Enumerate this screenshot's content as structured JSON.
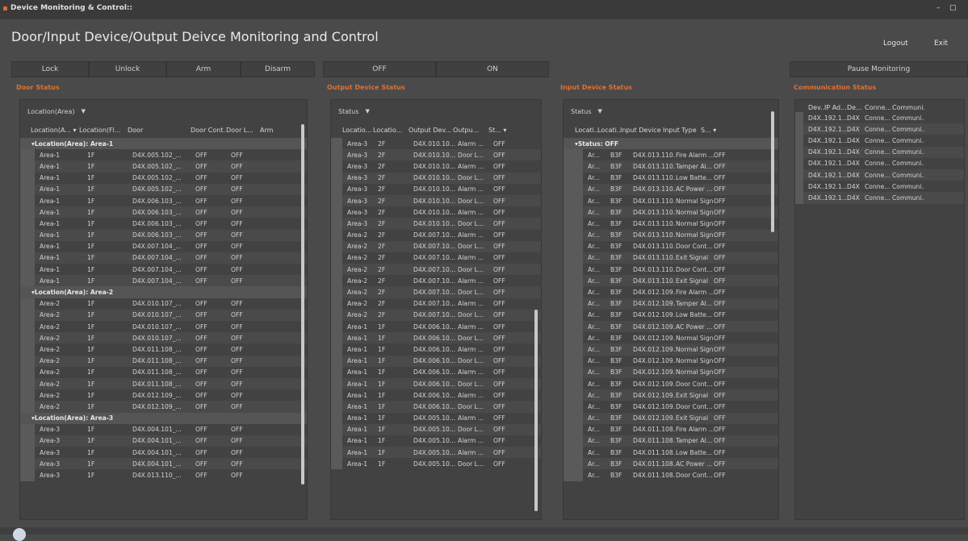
{
  "window": {
    "title": "Device Monitoring & Control::",
    "minimize": "–",
    "maximize": "▢"
  },
  "heading": "Door/Input Device/Output Deivce Monitoring and Control",
  "links": {
    "logout": "Logout",
    "exit": "Exit"
  },
  "door_buttons": [
    "Lock",
    "Unlock",
    "Arm",
    "Disarm"
  ],
  "output_buttons": [
    "OFF",
    "ON"
  ],
  "pause_button": "Pause Monitoring",
  "sections": {
    "door": "Door Status",
    "output": "Output Device Status",
    "input": "Input Device Status",
    "comm": "Communication Status"
  },
  "door_panel": {
    "group_by": "Location(Area)",
    "headers": [
      "Location(A... ▾",
      "Location(Fl...",
      "Door",
      "Door Cont...",
      "Door L...",
      "Arm"
    ],
    "groups": [
      {
        "label": "Location(Area): Area-1",
        "rows": [
          [
            "Area-1",
            "1F",
            "D4X.005.102_...",
            "OFF",
            "OFF"
          ],
          [
            "Area-1",
            "1F",
            "D4X.005.102_...",
            "OFF",
            "OFF"
          ],
          [
            "Area-1",
            "1F",
            "D4X.005.102_...",
            "OFF",
            "OFF"
          ],
          [
            "Area-1",
            "1F",
            "D4X.005.102_...",
            "OFF",
            "OFF"
          ],
          [
            "Area-1",
            "1F",
            "D4X.006.103_...",
            "OFF",
            "OFF"
          ],
          [
            "Area-1",
            "1F",
            "D4X.006.103_...",
            "OFF",
            "OFF"
          ],
          [
            "Area-1",
            "1F",
            "D4X.006.103_...",
            "OFF",
            "OFF"
          ],
          [
            "Area-1",
            "1F",
            "D4X.006.103_...",
            "OFF",
            "OFF"
          ],
          [
            "Area-1",
            "1F",
            "D4X.007.104_...",
            "OFF",
            "OFF"
          ],
          [
            "Area-1",
            "1F",
            "D4X.007.104_...",
            "OFF",
            "OFF"
          ],
          [
            "Area-1",
            "1F",
            "D4X.007.104_...",
            "OFF",
            "OFF"
          ],
          [
            "Area-1",
            "1F",
            "D4X.007.104_...",
            "OFF",
            "OFF"
          ]
        ]
      },
      {
        "label": "Location(Area): Area-2",
        "rows": [
          [
            "Area-2",
            "1F",
            "D4X.010.107_...",
            "OFF",
            "OFF"
          ],
          [
            "Area-2",
            "1F",
            "D4X.010.107_...",
            "OFF",
            "OFF"
          ],
          [
            "Area-2",
            "1F",
            "D4X.010.107_...",
            "OFF",
            "OFF"
          ],
          [
            "Area-2",
            "1F",
            "D4X.010.107_...",
            "OFF",
            "OFF"
          ],
          [
            "Area-2",
            "1F",
            "D4X.011.108_...",
            "OFF",
            "OFF"
          ],
          [
            "Area-2",
            "1F",
            "D4X.011.108_...",
            "OFF",
            "OFF"
          ],
          [
            "Area-2",
            "1F",
            "D4X.011.108_...",
            "OFF",
            "OFF"
          ],
          [
            "Area-2",
            "1F",
            "D4X.011.108_...",
            "OFF",
            "OFF"
          ],
          [
            "Area-2",
            "1F",
            "D4X.012.109_...",
            "OFF",
            "OFF"
          ],
          [
            "Area-2",
            "1F",
            "D4X.012.109_...",
            "OFF",
            "OFF"
          ]
        ]
      },
      {
        "label": "Location(Area): Area-3",
        "rows": [
          [
            "Area-3",
            "1F",
            "D4X.004.101_...",
            "OFF",
            "OFF"
          ],
          [
            "Area-3",
            "1F",
            "D4X.004.101_...",
            "OFF",
            "OFF"
          ],
          [
            "Area-3",
            "1F",
            "D4X.004.101_...",
            "OFF",
            "OFF"
          ],
          [
            "Area-3",
            "1F",
            "D4X.004.101_...",
            "OFF",
            "OFF"
          ],
          [
            "Area-3",
            "1F",
            "D4X.013.110_...",
            "OFF",
            "OFF"
          ]
        ]
      }
    ]
  },
  "output_panel": {
    "group_by": "Status",
    "headers": [
      "Locatio...",
      "Locatio...",
      "Output Dev...",
      "Outpu...",
      "St... ▾"
    ],
    "rows": [
      [
        "Area-3",
        "2F",
        "D4X.010.10...",
        "Alarm ...",
        "OFF"
      ],
      [
        "Area-3",
        "2F",
        "D4X.010.10...",
        "Door L...",
        "OFF"
      ],
      [
        "Area-3",
        "2F",
        "D4X.010.10...",
        "Alarm ...",
        "OFF"
      ],
      [
        "Area-3",
        "2F",
        "D4X.010.10...",
        "Door L...",
        "OFF"
      ],
      [
        "Area-3",
        "2F",
        "D4X.010.10...",
        "Alarm ...",
        "OFF"
      ],
      [
        "Area-3",
        "2F",
        "D4X.010.10...",
        "Door L...",
        "OFF"
      ],
      [
        "Area-3",
        "2F",
        "D4X.010.10...",
        "Alarm ...",
        "OFF"
      ],
      [
        "Area-3",
        "2F",
        "D4X.010.10...",
        "Door L...",
        "OFF"
      ],
      [
        "Area-2",
        "2F",
        "D4X.007.10...",
        "Alarm ...",
        "OFF"
      ],
      [
        "Area-2",
        "2F",
        "D4X.007.10...",
        "Door L...",
        "OFF"
      ],
      [
        "Area-2",
        "2F",
        "D4X.007.10...",
        "Alarm ...",
        "OFF"
      ],
      [
        "Area-2",
        "2F",
        "D4X.007.10...",
        "Door L...",
        "OFF"
      ],
      [
        "Area-2",
        "2F",
        "D4X.007.10...",
        "Alarm ...",
        "OFF"
      ],
      [
        "Area-2",
        "2F",
        "D4X.007.10...",
        "Door L...",
        "OFF"
      ],
      [
        "Area-2",
        "2F",
        "D4X.007.10...",
        "Alarm ...",
        "OFF"
      ],
      [
        "Area-2",
        "2F",
        "D4X.007.10...",
        "Door L...",
        "OFF"
      ],
      [
        "Area-1",
        "1F",
        "D4X.006.10...",
        "Alarm ...",
        "OFF"
      ],
      [
        "Area-1",
        "1F",
        "D4X.006.10...",
        "Door L...",
        "OFF"
      ],
      [
        "Area-1",
        "1F",
        "D4X.006.10...",
        "Alarm ...",
        "OFF"
      ],
      [
        "Area-1",
        "1F",
        "D4X.006.10...",
        "Door L...",
        "OFF"
      ],
      [
        "Area-1",
        "1F",
        "D4X.006.10...",
        "Alarm ...",
        "OFF"
      ],
      [
        "Area-1",
        "1F",
        "D4X.006.10...",
        "Door L...",
        "OFF"
      ],
      [
        "Area-1",
        "1F",
        "D4X.006.10...",
        "Alarm ...",
        "OFF"
      ],
      [
        "Area-1",
        "1F",
        "D4X.006.10...",
        "Door L...",
        "OFF"
      ],
      [
        "Area-1",
        "1F",
        "D4X.005.10...",
        "Alarm ...",
        "OFF"
      ],
      [
        "Area-1",
        "1F",
        "D4X.005.10...",
        "Door L...",
        "OFF"
      ],
      [
        "Area-1",
        "1F",
        "D4X.005.10...",
        "Alarm ...",
        "OFF"
      ],
      [
        "Area-1",
        "1F",
        "D4X.005.10...",
        "Alarm ...",
        "OFF"
      ],
      [
        "Area-1",
        "1F",
        "D4X.005.10...",
        "Door L...",
        "OFF"
      ]
    ]
  },
  "input_panel": {
    "group_by": "Status",
    "headers": [
      "Locati...",
      "Locati...",
      "Input Device",
      "Input Type",
      "S... ▾"
    ],
    "group_label": "Status: OFF",
    "rows": [
      [
        "Ar...",
        "B3F",
        "D4X.013.110...",
        "Fire Alarm ...",
        "OFF"
      ],
      [
        "Ar...",
        "B3F",
        "D4X.013.110...",
        "Tamper Al...",
        "OFF"
      ],
      [
        "Ar...",
        "B3F",
        "D4X.013.110...",
        "Low Batte...",
        "OFF"
      ],
      [
        "Ar...",
        "B3F",
        "D4X.013.110...",
        "AC Power ...",
        "OFF"
      ],
      [
        "Ar...",
        "B3F",
        "D4X.013.110...",
        "Normal Signal",
        "OFF"
      ],
      [
        "Ar...",
        "B3F",
        "D4X.013.110...",
        "Normal Signal",
        "OFF"
      ],
      [
        "Ar...",
        "B3F",
        "D4X.013.110...",
        "Normal Signal",
        "OFF"
      ],
      [
        "Ar...",
        "B3F",
        "D4X.013.110...",
        "Normal Signal",
        "OFF"
      ],
      [
        "Ar...",
        "B3F",
        "D4X.013.110...",
        "Door Cont...",
        "OFF"
      ],
      [
        "Ar...",
        "B3F",
        "D4X.013.110...",
        "Exit Signal",
        "OFF"
      ],
      [
        "Ar...",
        "B3F",
        "D4X.013.110...",
        "Door Cont...",
        "OFF"
      ],
      [
        "Ar...",
        "B3F",
        "D4X.013.110...",
        "Exit Signal",
        "OFF"
      ],
      [
        "Ar...",
        "B3F",
        "D4X.012.109...",
        "Fire Alarm ...",
        "OFF"
      ],
      [
        "Ar...",
        "B3F",
        "D4X.012.109...",
        "Tamper Al...",
        "OFF"
      ],
      [
        "Ar...",
        "B3F",
        "D4X.012.109...",
        "Low Batte...",
        "OFF"
      ],
      [
        "Ar...",
        "B3F",
        "D4X.012.109...",
        "AC Power ...",
        "OFF"
      ],
      [
        "Ar...",
        "B3F",
        "D4X.012.109...",
        "Normal Signal",
        "OFF"
      ],
      [
        "Ar...",
        "B3F",
        "D4X.012.109...",
        "Normal Signal",
        "OFF"
      ],
      [
        "Ar...",
        "B3F",
        "D4X.012.109...",
        "Normal Signal",
        "OFF"
      ],
      [
        "Ar...",
        "B3F",
        "D4X.012.109...",
        "Normal Signal",
        "OFF"
      ],
      [
        "Ar...",
        "B3F",
        "D4X.012.109...",
        "Door Cont...",
        "OFF"
      ],
      [
        "Ar...",
        "B3F",
        "D4X.012.109...",
        "Exit Signal",
        "OFF"
      ],
      [
        "Ar...",
        "B3F",
        "D4X.012.109...",
        "Door Cont...",
        "OFF"
      ],
      [
        "Ar...",
        "B3F",
        "D4X.012.109...",
        "Exit Signal",
        "OFF"
      ],
      [
        "Ar...",
        "B3F",
        "D4X.011.108...",
        "Fire Alarm ...",
        "OFF"
      ],
      [
        "Ar...",
        "B3F",
        "D4X.011.108...",
        "Tamper Al...",
        "OFF"
      ],
      [
        "Ar...",
        "B3F",
        "D4X.011.108...",
        "Low Batte...",
        "OFF"
      ],
      [
        "Ar...",
        "B3F",
        "D4X.011.108...",
        "AC Power ...",
        "OFF"
      ],
      [
        "Ar...",
        "B3F",
        "D4X.011.108...",
        "Door Cont...",
        "OFF"
      ]
    ]
  },
  "comm_panel": {
    "headers": [
      "Dev...",
      "IP Ad...",
      "De...",
      "Conne...",
      "Communi..."
    ],
    "rows": [
      [
        "D4X...",
        "192.1...",
        "D4X",
        "Conne...",
        "Communi..."
      ],
      [
        "D4X...",
        "192.1...",
        "D4X",
        "Conne...",
        "Communi..."
      ],
      [
        "D4X...",
        "192.1...",
        "D4X",
        "Conne...",
        "Communi..."
      ],
      [
        "D4X...",
        "192.1...",
        "D4X",
        "Conne...",
        "Communi..."
      ],
      [
        "D4X...",
        "192.1...",
        "D4X",
        "Conne...",
        "Communi..."
      ],
      [
        "D4X...",
        "192.1...",
        "D4X",
        "Conne...",
        "Communi..."
      ],
      [
        "D4X...",
        "192.1...",
        "D4X",
        "Conne...",
        "Communi..."
      ],
      [
        "D4X...",
        "192.1...",
        "D4X",
        "Conne...",
        "Communi..."
      ]
    ]
  },
  "colors": {
    "accent": "#e07030",
    "background": "#4a4a4a"
  }
}
